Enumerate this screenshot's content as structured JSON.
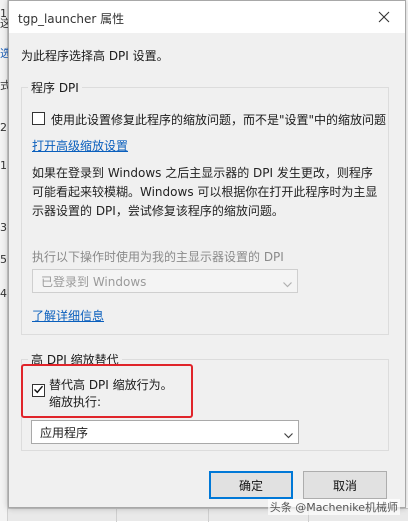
{
  "background": {
    "edge_chars": [
      "1",
      "这",
      "选",
      "式",
      "2",
      "1",
      "3",
      "5",
      "4"
    ],
    "edge_link_char": "选"
  },
  "dialog": {
    "title": "tgp_launcher 属性",
    "intro": "为此程序选择高 DPI 设置。"
  },
  "program_dpi": {
    "legend": "程序 DPI",
    "checkbox_label": "使用此设置修复此程序的缩放问题，而不是\"设置\"中的缩放问题",
    "checkbox_checked": false,
    "advanced_link": "打开高级缩放设置",
    "description_lines": [
      "如果在登录到 Windows 之后主显示器的 DPI 发生更改，则程序",
      "可能看起来较模糊。Windows 可以根据你在打开此程序时为主显",
      "示器设置的 DPI，尝试修复该程序的缩放问题。"
    ],
    "select_label": "执行以下操作时使用为我的主显示器设置的 DPI",
    "select_value": "已登录到 Windows",
    "learn_more_link": "了解详细信息"
  },
  "high_dpi": {
    "legend": "高 DPI 缩放替代",
    "override_line1": "替代高 DPI 缩放行为。",
    "override_line2": "缩放执行:",
    "override_checked": true,
    "scaling_select_value": "应用程序"
  },
  "buttons": {
    "ok": "确定",
    "cancel": "取消"
  },
  "watermark": "头条 @Machenike机械师",
  "colors": {
    "accent": "#0078d7",
    "link": "#0a5fbd",
    "highlight": "#e0242a"
  },
  "icons": {
    "close": "close-icon",
    "checkmark": "checkmark-icon",
    "chevron": "chevron-down-icon"
  }
}
